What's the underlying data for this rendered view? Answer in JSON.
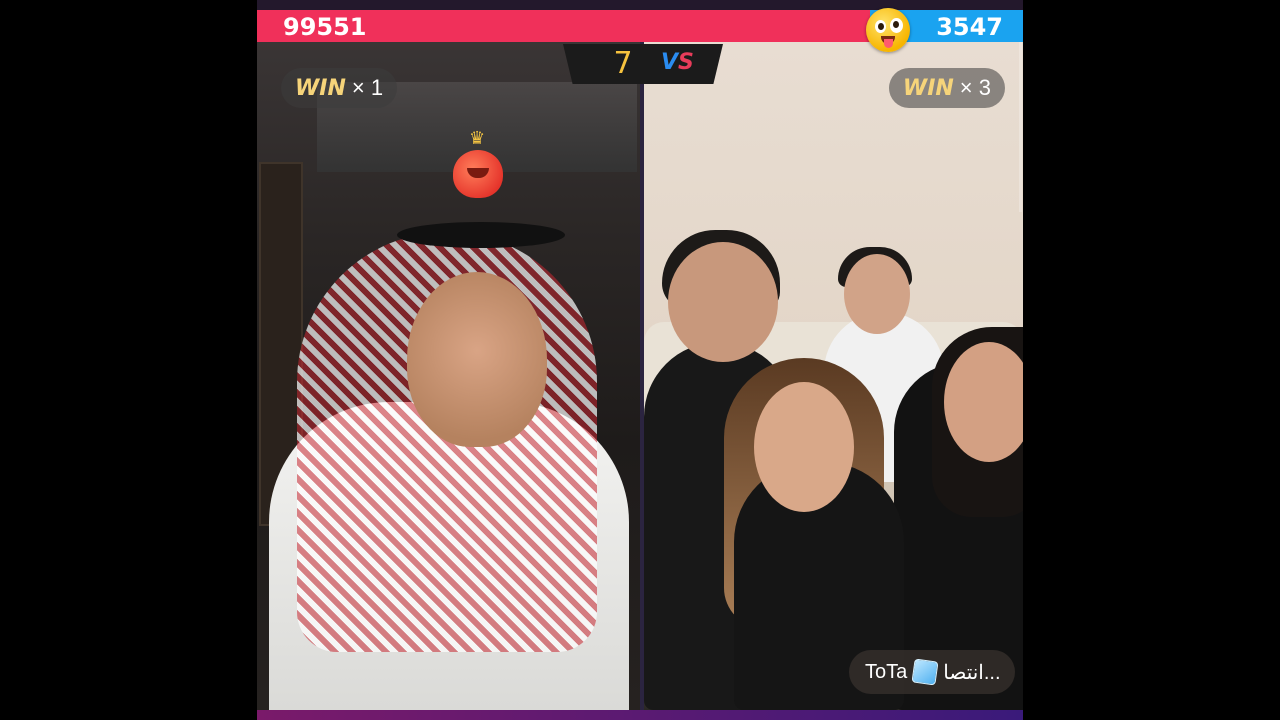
{
  "battle": {
    "left_score": "99551",
    "right_score": "3547",
    "left_share": 0.8,
    "round_number": "7",
    "vs_label_v": "V",
    "vs_label_s": "S"
  },
  "left_host": {
    "win_label": "WIN",
    "win_count": "× 1"
  },
  "right_host": {
    "win_label": "WIN",
    "win_count": "× 3"
  },
  "comment": {
    "text_arabic": "انتصا...",
    "text_name": "ToTa"
  },
  "colors": {
    "left_score_bar": "#f0305a",
    "right_score_bar": "#1aa3f0",
    "win_text": "#f6d47a",
    "round_number": "#f6c23e"
  },
  "icons": [
    "emoji-tongue-icon",
    "heart-crown-sticker-icon",
    "ice-cube-icon"
  ]
}
